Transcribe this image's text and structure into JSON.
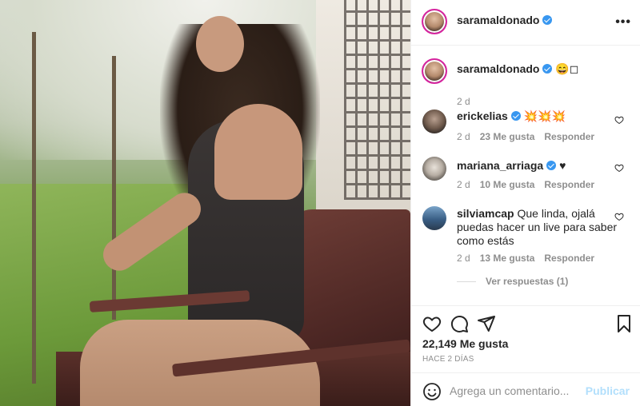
{
  "post": {
    "username": "saramaldonado",
    "more_label": "•••"
  },
  "caption": {
    "username": "saramaldonado",
    "text": "😄◻",
    "age": "2 d"
  },
  "comments": [
    {
      "username": "erickelias",
      "verified": true,
      "text": "💥💥💥",
      "age": "2 d",
      "likes": "23 Me gusta",
      "reply": "Responder"
    },
    {
      "username": "mariana_arriaga",
      "verified": true,
      "text": "♥",
      "age": "2 d",
      "likes": "10 Me gusta",
      "reply": "Responder"
    },
    {
      "username": "silviamcap",
      "verified": false,
      "text": "Que linda, ojalá puedas hacer un live para saber como estás",
      "age": "2 d",
      "likes": "13 Me gusta",
      "reply": "Responder"
    }
  ],
  "view_replies": "Ver respuestas (1)",
  "likes_count": "22,149 Me gusta",
  "posted": "HACE 2 DÍAS",
  "add_comment": {
    "placeholder": "Agrega un comentario...",
    "post_label": "Publicar"
  },
  "colors": {
    "verified": "#3897f0",
    "publish_disabled": "#b2dffc",
    "muted": "#8e8e8e"
  }
}
